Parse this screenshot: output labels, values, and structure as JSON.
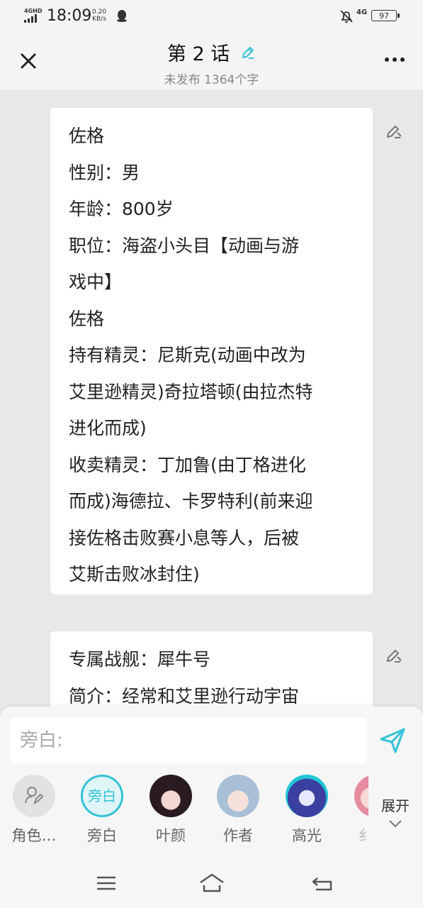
{
  "status_bar": {
    "network": "4GHD",
    "time": "18:09",
    "speed_value": "0.20",
    "speed_unit": "KB/s",
    "signal_right": "4G",
    "battery": "97"
  },
  "header": {
    "title": "第 2 话",
    "subtitle": "未发布 1364个字"
  },
  "cards": [
    {
      "paragraphs": [
        "佐格",
        "性别：男",
        "年龄：800岁",
        "职位：海盗小头目【动画与游\n戏中】",
        "佐格",
        "持有精灵：尼斯克(动画中改为\n艾里逊精灵)奇拉塔顿(由拉杰特\n进化而成)",
        "收卖精灵：丁加鲁(由丁格进化\n而成)海德拉、卡罗特利(前来迎\n接佐格击败赛小息等人，后被\n艾斯击败冰封住)"
      ]
    },
    {
      "paragraphs": [
        "专属战舰：犀牛号",
        "简介：经常和艾里逊行动宇宙"
      ]
    }
  ],
  "composer": {
    "placeholder": "旁白:"
  },
  "roles": [
    {
      "label": "角色…",
      "avatar_text": ""
    },
    {
      "label": "旁白",
      "avatar_text": "旁白"
    },
    {
      "label": "叶颜",
      "avatar_text": ""
    },
    {
      "label": "作者",
      "avatar_text": ""
    },
    {
      "label": "高光",
      "avatar_text": ""
    },
    {
      "label": "纟",
      "avatar_text": ""
    }
  ],
  "expand_label": "展开",
  "colors": {
    "accent": "#35c3d6",
    "background": "#e8e8e8"
  }
}
